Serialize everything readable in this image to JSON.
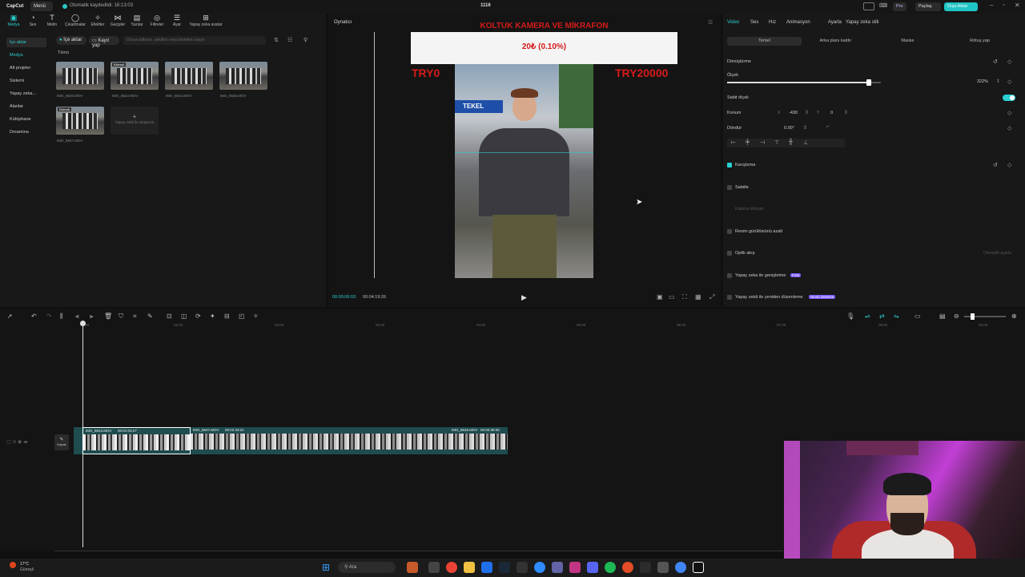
{
  "titlebar": {
    "app_name": "CapCut",
    "menu_label": "Menü",
    "autosave_text": "Otomatik kaydedildi: 16:13:03",
    "project_name": "1116",
    "pro_label": "Pro",
    "share_label": "Paylaş",
    "export_label": "Dışa Aktar"
  },
  "toolbar": {
    "tools": [
      {
        "label": "Medya",
        "icon": "media-icon"
      },
      {
        "label": "Ses",
        "icon": "audio-icon"
      },
      {
        "label": "Metin",
        "icon": "text-icon"
      },
      {
        "label": "Çıkartmalar",
        "icon": "sticker-icon"
      },
      {
        "label": "Efektler",
        "icon": "effects-icon"
      },
      {
        "label": "Geçişler",
        "icon": "transitions-icon"
      },
      {
        "label": "Yazılar",
        "icon": "captions-icon"
      },
      {
        "label": "Filtreler",
        "icon": "filters-icon"
      },
      {
        "label": "Ayar",
        "icon": "adjust-icon"
      },
      {
        "label": "Yapay zeka avatar",
        "icon": "ai-avatar-icon"
      }
    ]
  },
  "left_nav": {
    "items": [
      "İçe aktar",
      "Medya",
      "Alt projeler",
      "Sistemi",
      "Yapay zeka...",
      "Alanlar",
      "Kütüphane",
      "Dreamina"
    ]
  },
  "media": {
    "import_button": "İçe aktar",
    "record_button": "Kayıt yap",
    "search_placeholder": "Dosya adlarını, şekilleri veya ifadeleri arayın",
    "filter_all": "Tümü",
    "added_badge": "Eklendi",
    "files": [
      "IMG_8640.MOV",
      "IMG_8643.MOV",
      "IMG_8644.MOV",
      "IMG_8646.MOV",
      "IMG_8647.MOV"
    ],
    "ai_generate_label": "Yapay zekâ ile oluşturun"
  },
  "player": {
    "title": "Oynatıcı",
    "headline": "KOLTUK KAMERA VE MİKRAFON",
    "price_box": "20₺ (0.10%)",
    "left_price": "TRY0",
    "right_price": "TRY20000",
    "current_time": "00:00:06:03",
    "total_time": "00:04:19:26",
    "shop_sign": "TEKEL"
  },
  "properties": {
    "tabs": [
      "Video",
      "Ses",
      "Hız",
      "Animasyon",
      "Ayarla",
      "Yapay zeka stili"
    ],
    "sub_tabs": [
      "Temel",
      "Arka planı kaldır",
      "Maske",
      "Rötuş yap"
    ],
    "transform_label": "Dönüştürme",
    "scale_label": "Ölçek",
    "scale_value": "322%",
    "scale_fraction": 0.92,
    "uniform_scale_label": "Sabit ölçek",
    "position_label": "Konum",
    "pos_x_label": "X",
    "pos_x": "-430",
    "pos_y_label": "Y",
    "pos_y": "0",
    "rotate_label": "Döndür",
    "rotate_value": "0.00°",
    "blend_label": "Karıştırma",
    "stabilize_label": "Sabitle",
    "stabilize_sub": "Kaldırıp öldeşim",
    "denoise_label": "Resim gürültüsünü azalt",
    "optical_flow_label": "Optik akış",
    "optical_flow_action": "Otomatik ayarla",
    "ai_expand_label": "Yapay zeka ile genişletme",
    "ai_expand_badge": "Free",
    "ai_relayout_label": "Yapay zekâ ile yeniden düzenleme",
    "ai_relayout_badge": "Sınırlı deneme"
  },
  "timeline": {
    "ruler": [
      "00:00",
      "01:00",
      "02:00",
      "03:00",
      "04:00",
      "05:00",
      "06:00",
      "07:00",
      "08:00",
      "09:00"
    ],
    "cover_label": "Kapak",
    "clips": [
      {
        "name": "IMG_8643.MOV",
        "duration": "00:01:03:27"
      },
      {
        "name": "IMG_8647.MOV",
        "duration": "00:02:33:21"
      },
      {
        "name": "IMG_8645.MOV",
        "duration": "00:00:36:06"
      }
    ]
  },
  "taskbar": {
    "weather_temp": "17°C",
    "weather_desc": "Güneşli",
    "search_label": "Ara"
  }
}
